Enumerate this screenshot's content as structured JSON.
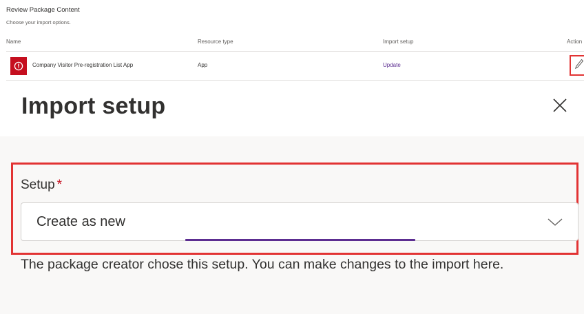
{
  "review": {
    "title": "Review Package Content",
    "subtitle": "Choose your import options.",
    "columns": {
      "name": "Name",
      "resource_type": "Resource type",
      "import_setup": "Import setup",
      "actions": "Action"
    },
    "row": {
      "icon": "error-circle-icon",
      "name": "Company Visitor Pre-registration List App",
      "resource_type": "App",
      "import_setup": "Update",
      "action_icon": "edit-pencil-icon"
    }
  },
  "panel": {
    "title": "Import setup",
    "close_icon": "close-icon",
    "setup_label": "Setup",
    "required_marker": "*",
    "dropdown_value": "Create as new",
    "chevron_icon": "chevron-down-icon",
    "help_text": "The package creator chose this setup. You can make changes to the import here."
  },
  "colors": {
    "brand_red": "#c50f1f",
    "highlight_red": "#e23333",
    "link_purple": "#5c2d91",
    "panel_background": "#f9f8f7"
  }
}
